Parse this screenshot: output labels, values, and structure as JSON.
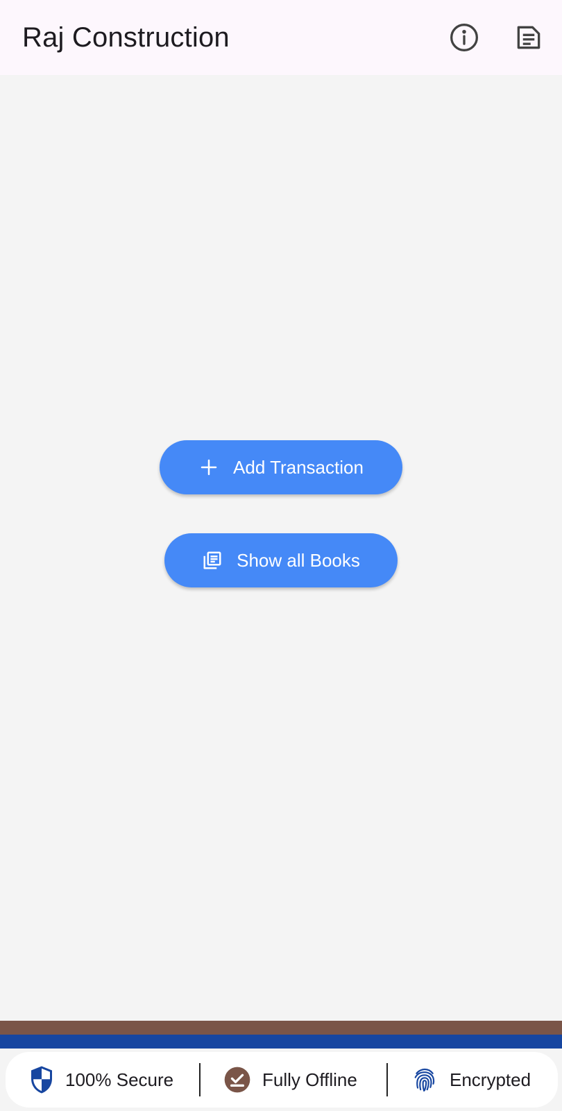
{
  "app_bar": {
    "title": "Raj Construction",
    "icons": [
      "info-icon",
      "notes-icon"
    ]
  },
  "actions": {
    "add_transaction": {
      "label": "Add Transaction",
      "icon": "plus-icon"
    },
    "show_all_books": {
      "label": "Show all Books",
      "icon": "library-books-icon"
    }
  },
  "footer": {
    "items": [
      {
        "label": "100% Secure",
        "icon": "shield-icon"
      },
      {
        "label": "Fully Offline",
        "icon": "offline-check-icon"
      },
      {
        "label": "Encrypted",
        "icon": "fingerprint-icon"
      }
    ]
  },
  "colors": {
    "app_bar_bg": "#fdf7fd",
    "background": "#f4f4f4",
    "button": "#4589f7",
    "stripe_brown": "#7a5548",
    "stripe_blue": "#1746a0",
    "shield_blue": "#1746a0",
    "offline_brown": "#7a5548"
  }
}
